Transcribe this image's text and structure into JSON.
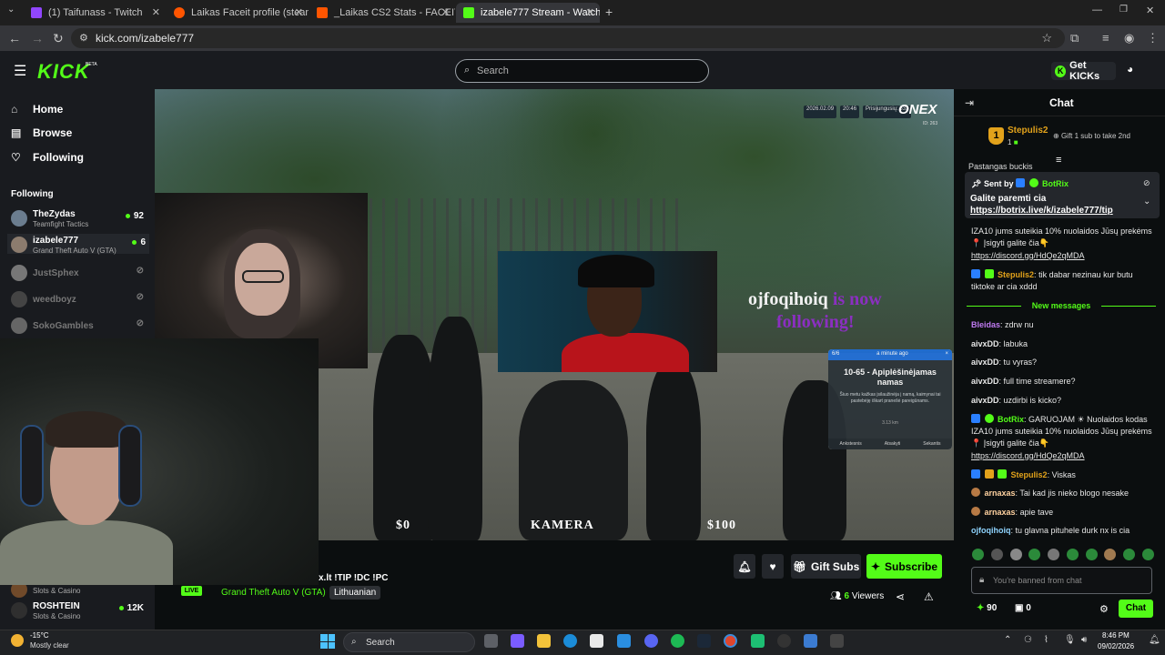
{
  "browser": {
    "tabs": [
      {
        "label": "(1) Taifunass - Twitch",
        "color": "#9146ff"
      },
      {
        "label": "Laikas Faceit profile (steamid 7...",
        "color": "#ff5500"
      },
      {
        "label": "_Laikas CS2 Stats - FACEIT.com",
        "color": "#ff5500"
      },
      {
        "label": "izabele777 Stream - Watch",
        "color": "#53fc18"
      }
    ],
    "url": "kick.com/izabele777"
  },
  "header": {
    "logo": "KICK",
    "beta": "BETA",
    "search_placeholder": "Search",
    "get_kicks": "Get KICKs"
  },
  "sidebar": {
    "nav": [
      {
        "label": "Home",
        "icon": "home-icon"
      },
      {
        "label": "Browse",
        "icon": "browse-icon"
      },
      {
        "label": "Following",
        "icon": "heart-icon"
      }
    ],
    "following_heading": "Following",
    "channels": [
      {
        "name": "TheZydas",
        "game": "Teamfight Tactics",
        "viewers": "92",
        "live": true
      },
      {
        "name": "izabele777",
        "game": "Grand Theft Auto V (GTA)",
        "viewers": "6",
        "live": true
      },
      {
        "name": "JustSphex",
        "game": "",
        "viewers": "",
        "live": false
      },
      {
        "name": "weedboyz",
        "game": "",
        "viewers": "",
        "live": false
      },
      {
        "name": "SokoGambles",
        "game": "",
        "viewers": "",
        "live": false
      }
    ],
    "bottom_channels": [
      {
        "name": "",
        "game": "Slots & Casino",
        "viewers": ""
      },
      {
        "name": "ROSHTEIN",
        "game": "Slots & Casino",
        "viewers": "12K"
      }
    ]
  },
  "video": {
    "hud_date": "2026.02.09",
    "hud_time": "20:46",
    "hud_players": "Prisijungusių: 533",
    "hud_id": "ID: 263",
    "logo": "ONEX",
    "follow_name": "ojfoqihoiq",
    "follow_is_now": "is now",
    "follow_following": "following!",
    "money_left": "$0",
    "camera": "KAMERA",
    "money_right": "$100",
    "phone": {
      "counter": "6/6",
      "time": "a minute ago",
      "title": "10-65 - Apiplėšinėjamas namas",
      "desc": "Šiuo metu kažkas įsilaužinėja į namą, kaimynai tai pastebėję iškart pranešė pareigūnams.",
      "time2": "3.13 km",
      "btns": [
        "Ankstesnis",
        "Atsakyti",
        "Sekantis"
      ]
    }
  },
  "stream": {
    "title": "x.lt !TIP !DC !PC",
    "live": "LIVE",
    "category": "Grand Theft Auto V (GTA)",
    "language": "Lithuanian",
    "gift_subs": "Gift Subs",
    "subscribe": "Subscribe",
    "viewers_count": "6",
    "viewers_label": "Viewers"
  },
  "chat": {
    "title": "Chat",
    "gift_top": {
      "rank": "1",
      "user": "Stepulis2",
      "count": "1",
      "cta": "Gift 1 sub to take 2nd"
    },
    "pin_overflow": "Pastangas buckis",
    "pinned": {
      "sent_by": "Sent by",
      "bot": "BotRix",
      "line1": "Galite paremti cia",
      "link": "https://botrix.live/k/izabele777/tip"
    },
    "messages_top": [
      {
        "text": "IZA10 jums suteikia 10% nuolaidos Jūsų prekėms 📍 Įsigyti galite čia👇"
      },
      {
        "link": "https://discord.gg/HdQe2qMDA"
      },
      {
        "user": "Stepulis2",
        "color": "#e2a21b",
        "text": "tik dabar nezinau kur butu tiktoke ar cia xddd"
      }
    ],
    "new_messages": "New messages",
    "messages": [
      {
        "user": "Bleidas",
        "color": "#c07bf2",
        "text": "zdrw nu"
      },
      {
        "user": "aivxDD",
        "color": "#ffffff",
        "text": "labuka"
      },
      {
        "user": "aivxDD",
        "color": "#ffffff",
        "text": "tu vyras?"
      },
      {
        "user": "aivxDD",
        "color": "#ffffff",
        "text": "full time streamere?"
      },
      {
        "user": "aivxDD",
        "color": "#ffffff",
        "text": "uzdirbi is kicko?"
      },
      {
        "user": "BotRix",
        "color": "#53fc18",
        "text": "GARUOJAM ☀ Nuolaidos kodas IZA10 jums suteikia 10% nuolaidos Jūsų prekėms 📍 Įsigyti galite čia👇"
      },
      {
        "link": "https://discord.gg/HdQe2qMDA"
      },
      {
        "user": "Stepulis2",
        "color": "#e2a21b",
        "text": "Viskas"
      },
      {
        "user": "arnaxas",
        "color": "#ffd2a0",
        "text": "Tai kad jis nieko blogo nesake"
      },
      {
        "user": "arnaxas",
        "color": "#ffd2a0",
        "text": "apie tave"
      },
      {
        "user": "ojfoqihoiq",
        "color": "#8fd4ff",
        "text": "tu glavna pituhele durk nx is cia"
      }
    ],
    "input_placeholder": "You're banned from chat",
    "kicks": "90",
    "gifts": "0",
    "send": "Chat"
  },
  "taskbar": {
    "temp": "-15°C",
    "weather": "Mostly clear",
    "search": "Search",
    "time": "8:46 PM",
    "date": "09/02/2026"
  }
}
